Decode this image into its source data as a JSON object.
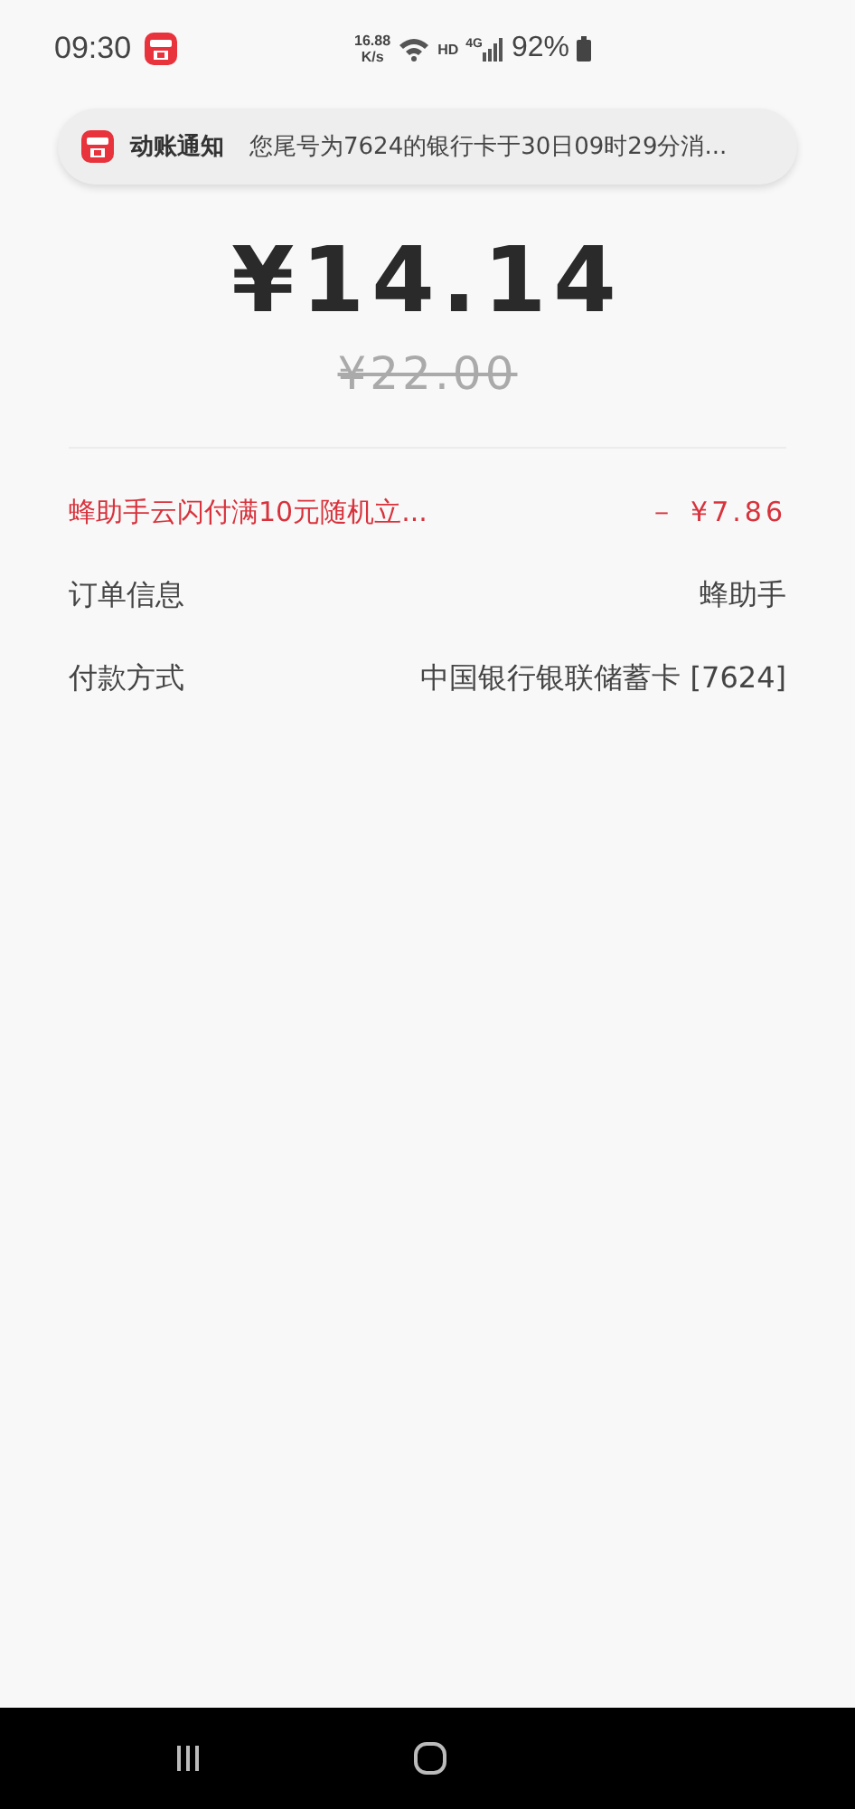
{
  "status_bar": {
    "time": "09:30",
    "speed_value": "16.88",
    "speed_unit": "K/s",
    "wifi_badge": "HD",
    "network": "4G",
    "battery": "92%"
  },
  "notification": {
    "title": "动账通知",
    "message": "您尾号为7624的银行卡于30日09时29分消..."
  },
  "payment": {
    "amount": "¥14.14",
    "original_amount": "¥22.00"
  },
  "rows": [
    {
      "kind": "discount",
      "label": "蜂助手云闪付满10元随机立...",
      "value": "－ ¥7.86"
    },
    {
      "kind": "info",
      "label": "订单信息",
      "value": "蜂助手"
    },
    {
      "kind": "info",
      "label": "付款方式",
      "value": "中国银行银联储蓄卡 [7624]"
    }
  ]
}
